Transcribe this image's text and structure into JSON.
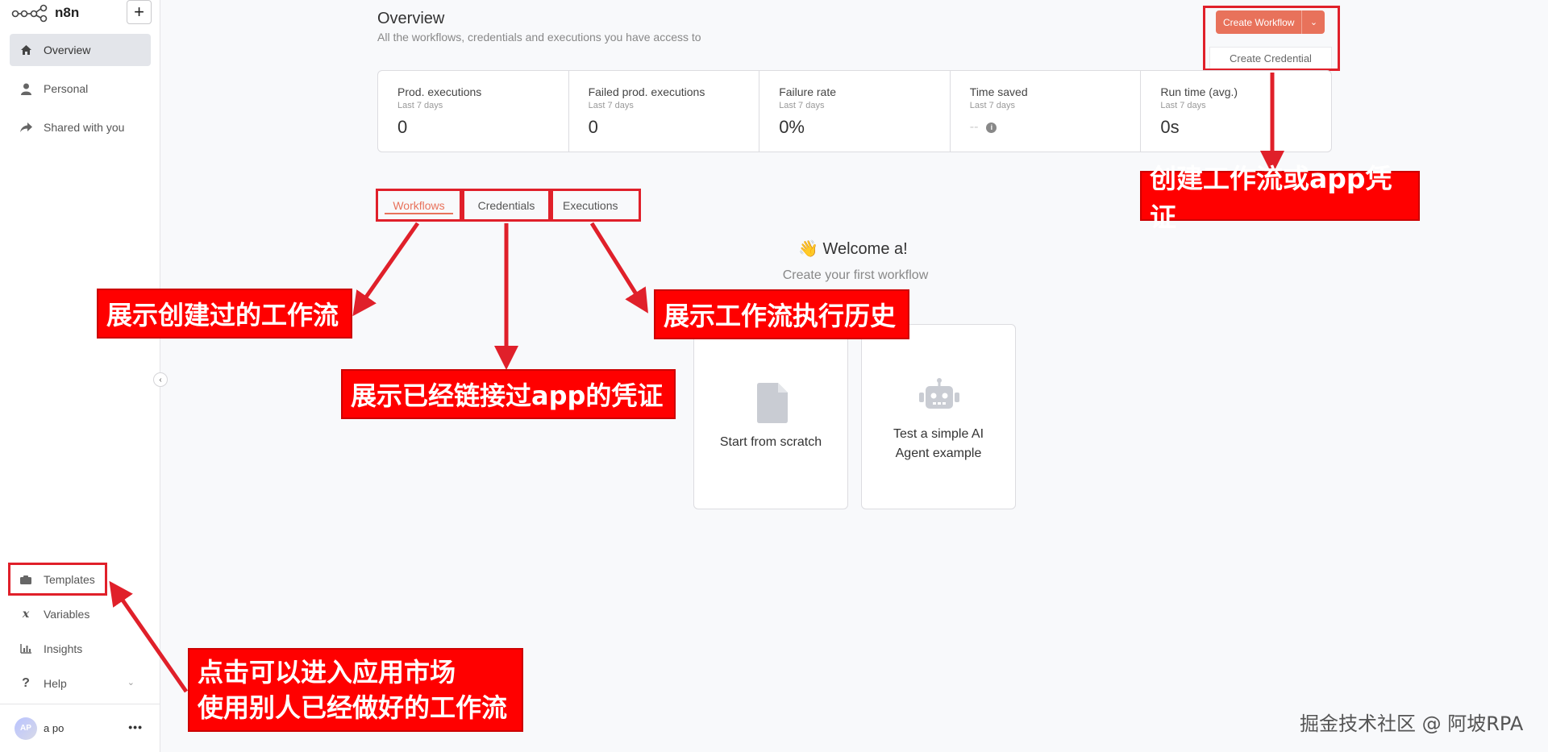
{
  "app": {
    "name": "n8n"
  },
  "sidebar": {
    "add_label": "+",
    "items": [
      {
        "label": "Overview",
        "icon": "home-icon"
      },
      {
        "label": "Personal",
        "icon": "user-icon"
      },
      {
        "label": "Shared with you",
        "icon": "share-icon"
      }
    ],
    "bottom_items": [
      {
        "label": "Templates",
        "icon": "templates-icon"
      },
      {
        "label": "Variables",
        "icon": "variables-icon"
      },
      {
        "label": "Insights",
        "icon": "insights-icon"
      },
      {
        "label": "Help",
        "icon": "help-icon"
      }
    ],
    "user": {
      "initials": "AP",
      "name": "a po",
      "more": "•••"
    }
  },
  "header": {
    "title": "Overview",
    "subtitle": "All the workflows, credentials and executions you have access to",
    "create_button": "Create Workflow",
    "dropdown_item": "Create Credential"
  },
  "stats": [
    {
      "label": "Prod. executions",
      "period": "Last 7 days",
      "value": "0"
    },
    {
      "label": "Failed prod. executions",
      "period": "Last 7 days",
      "value": "0"
    },
    {
      "label": "Failure rate",
      "period": "Last 7 days",
      "value": "0%"
    },
    {
      "label": "Time saved",
      "period": "Last 7 days",
      "value": "--"
    },
    {
      "label": "Run time (avg.)",
      "period": "Last 7 days",
      "value": "0s"
    }
  ],
  "tabs": [
    "Workflows",
    "Credentials",
    "Executions"
  ],
  "welcome": {
    "title": "👋 Welcome a!",
    "subtitle": "Create your first workflow"
  },
  "cards": [
    {
      "label": "Start from scratch"
    },
    {
      "label_line1": "Test a simple AI",
      "label_line2": "Agent example"
    }
  ],
  "annotations": {
    "create": "创建工作流或app凭证",
    "workflows": "展示创建过的工作流",
    "executions": "展示工作流执行历史",
    "credentials": "展示已经链接过app的凭证",
    "templates_line1": "点击可以进入应用市场",
    "templates_line2": "使用别人已经做好的工作流"
  },
  "watermark": "掘金技术社区 @ 阿坡RPA",
  "colors": {
    "accent": "#e8725b",
    "annotation": "#ff0000"
  }
}
